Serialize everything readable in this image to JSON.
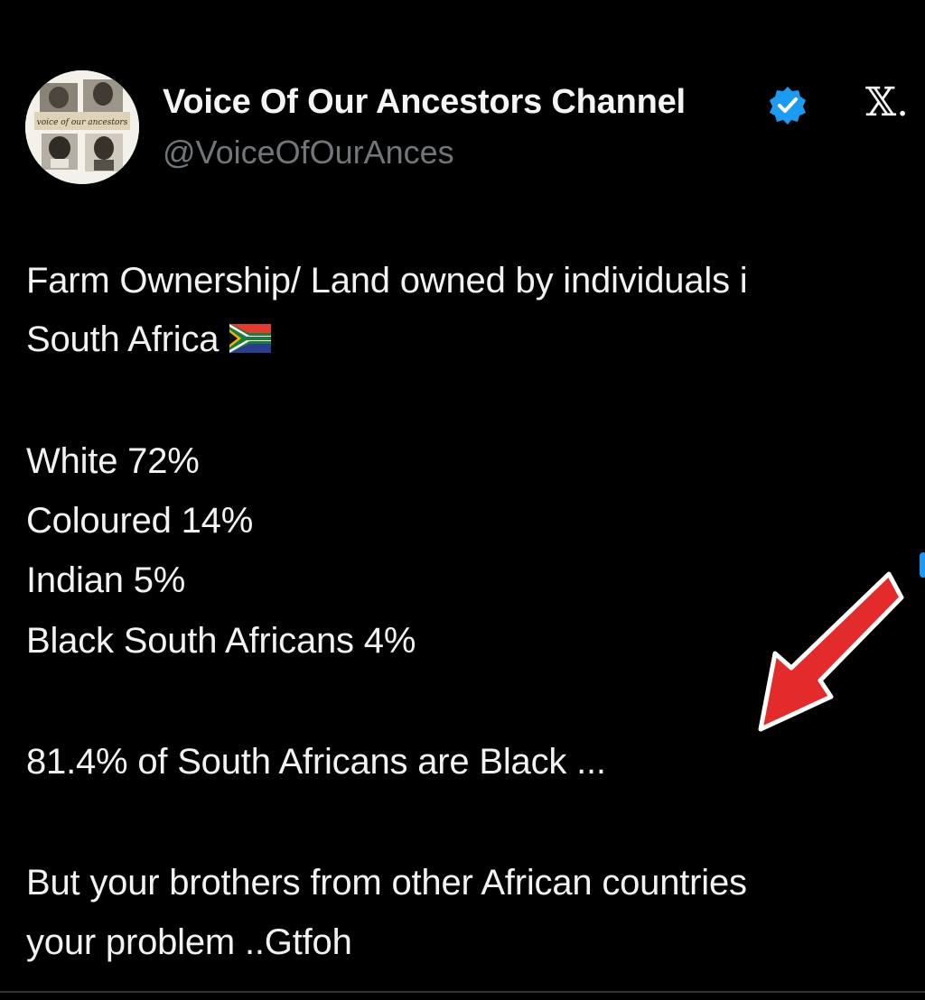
{
  "post": {
    "author": {
      "display_name": "Voice Of Our Ancestors Channel",
      "handle": "@VoiceOfOurAnces",
      "verified": true,
      "avatar_caption": "voice of our ancestors",
      "verified_icon": "verified-badge-icon"
    },
    "platform_mark": "𝕏.",
    "flag_icon": "south-africa-flag-icon",
    "body": {
      "line_1": "Farm Ownership/ Land owned by individuals i",
      "line_2": "South Africa",
      "stat_1": "White 72%",
      "stat_2": "Coloured 14%",
      "stat_3": "Indian 5%",
      "stat_4": "Black South Africans 4%",
      "line_3": "81.4% of South Africans are Black ...",
      "line_4": "But your brothers from other African countries",
      "line_5": "your problem ..Gtfoh"
    },
    "annotation": {
      "icon": "red-arrow-icon",
      "color": "#e32b2b"
    },
    "colors": {
      "background": "#000000",
      "text": "#f2f2f2",
      "muted": "#71767b",
      "verified": "#1d9bf0"
    }
  }
}
